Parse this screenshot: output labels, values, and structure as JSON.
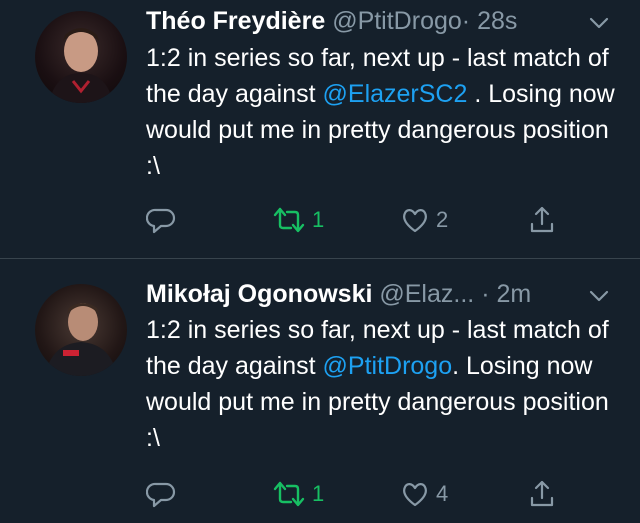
{
  "tweets": [
    {
      "name": "Théo Freydière",
      "handle": "@PtitDrogo",
      "dot": "·",
      "time": "28s",
      "text_before": "1:2 in series so far, next up - last match of the day against ",
      "mention": "@ElazerSC2",
      "text_after": " . Losing now would put me in pretty dangerous position :\\",
      "retweet_count": "1",
      "like_count": "2"
    },
    {
      "name": "Mikołaj Ogonowski",
      "handle": "@Elaz...",
      "dot": "·",
      "time": "2m",
      "text_before": "1:2 in series so far, next up - last match of the day against ",
      "mention": "@PtitDrogo",
      "text_after": ". Losing now would put me in pretty dangerous position :\\",
      "retweet_count": "1",
      "like_count": "4"
    }
  ],
  "colors": {
    "background": "#15202b",
    "divider": "#38444d",
    "mention": "#1da1f2",
    "retweet_active": "#17bf63",
    "muted": "#8899a6"
  },
  "icons": [
    "reply-icon",
    "retweet-icon",
    "like-icon",
    "share-icon",
    "chevron-down-icon"
  ]
}
